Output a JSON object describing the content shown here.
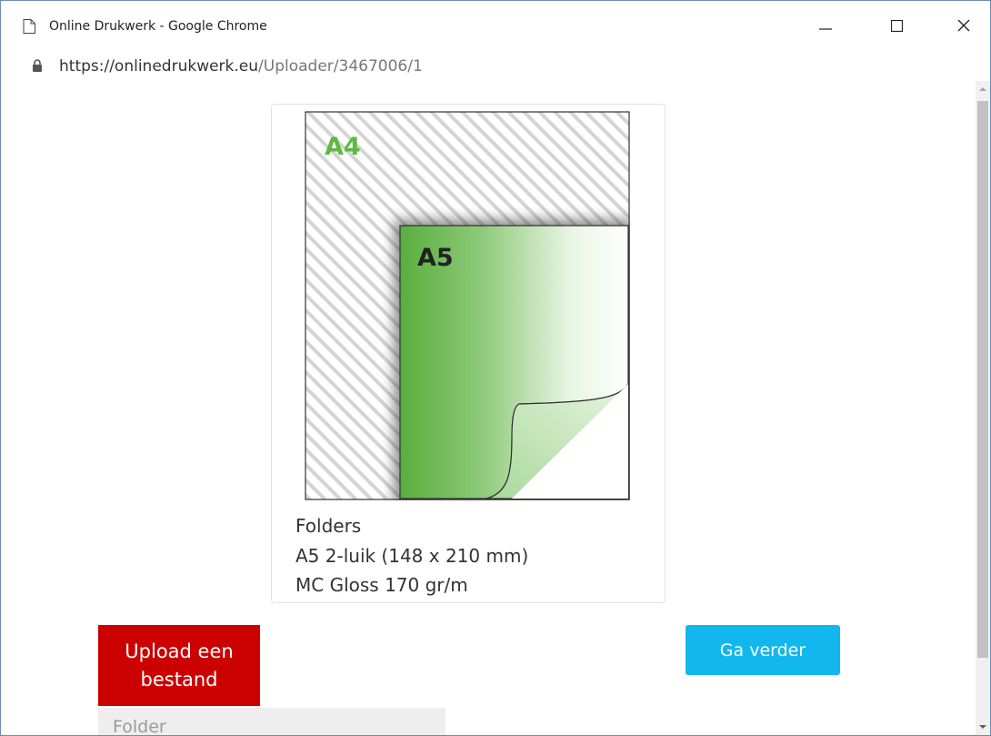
{
  "window": {
    "title": "Online Drukwerk - Google Chrome"
  },
  "address": {
    "domain": "https://onlinedrukwerk.eu",
    "path": "/Uploader/3467006/1"
  },
  "product": {
    "preview_outer_label": "A4",
    "preview_inner_label": "A5",
    "category": "Folders",
    "format": "A5 2-luik (148 x 210 mm)",
    "paper": "MC Gloss 170 gr/m"
  },
  "actions": {
    "upload_label": "Upload een bestand",
    "next_label": "Ga verder"
  },
  "folder_field": {
    "placeholder": "Folder"
  },
  "colors": {
    "upload_button": "#cc0000",
    "next_button": "#12b7ee",
    "label_green": "#5fb843",
    "sheet_green": "#5aae3e"
  }
}
